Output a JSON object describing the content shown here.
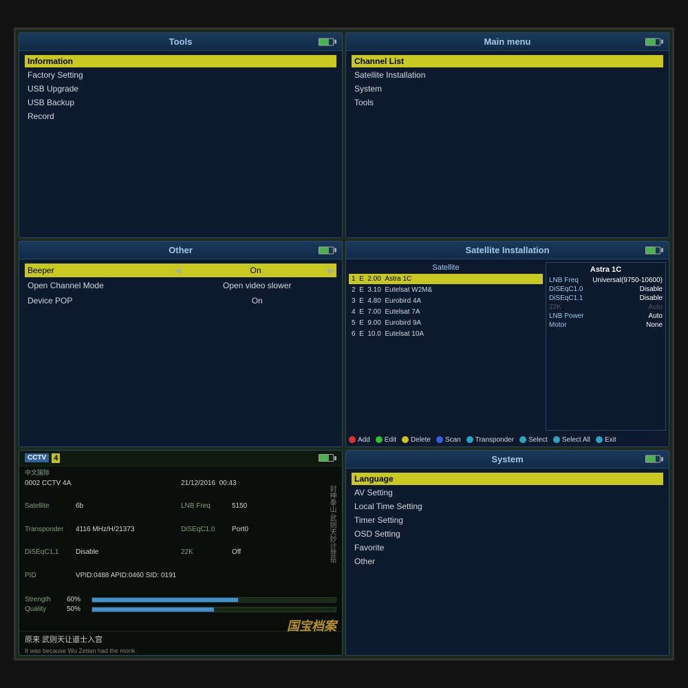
{
  "panels": {
    "tools": {
      "title": "Tools",
      "items": [
        {
          "label": "Information",
          "selected": true
        },
        {
          "label": "Factory Setting",
          "selected": false
        },
        {
          "label": "USB Upgrade",
          "selected": false
        },
        {
          "label": "USB Backup",
          "selected": false
        },
        {
          "label": "Record",
          "selected": false
        }
      ]
    },
    "main_menu": {
      "title": "Main menu",
      "items": [
        {
          "label": "Channel List",
          "selected": true
        },
        {
          "label": "Satellite Installation",
          "selected": false
        },
        {
          "label": "System",
          "selected": false
        },
        {
          "label": "Tools",
          "selected": false
        }
      ]
    },
    "other": {
      "title": "Other",
      "settings": [
        {
          "label": "Beeper",
          "value": "On",
          "selected": true
        },
        {
          "label": "Open Channel Mode",
          "value": "Open video slower",
          "selected": false
        },
        {
          "label": "Device POP",
          "value": "On",
          "selected": false
        }
      ]
    },
    "satellite": {
      "title": "Satellite Installation",
      "list_header": "Satellite",
      "satellites": [
        {
          "num": "1",
          "e": "E",
          "deg": "2.00",
          "name": "Astra 1C",
          "selected": true
        },
        {
          "num": "2",
          "e": "E",
          "deg": "3.10",
          "name": "Eutelsat W2M&",
          "selected": false
        },
        {
          "num": "3",
          "e": "E",
          "deg": "4.80",
          "name": "Eurobird 4A",
          "selected": false
        },
        {
          "num": "4",
          "e": "E",
          "deg": "7.00",
          "name": "Eutelsat 7A",
          "selected": false
        },
        {
          "num": "5",
          "e": "E",
          "deg": "9.00",
          "name": "Eurobird 9A",
          "selected": false
        },
        {
          "num": "6",
          "e": "E",
          "deg": "10.0",
          "name": "Eutelsat 10A",
          "selected": false
        }
      ],
      "details": {
        "title": "Astra 1C",
        "lnb_freq_label": "LNB Freq",
        "lnb_freq_value": "Universal(9750-10600)",
        "diseqc10_label": "DiSEqC1.0",
        "diseqc10_value": "Disable",
        "diseqc11_label": "DiSEqC1.1",
        "diseqc11_value": "Disable",
        "k22_label": "22K",
        "k22_value": "Auto",
        "lnb_power_label": "LNB Power",
        "lnb_power_value": "Auto",
        "motor_label": "Motor",
        "motor_value": "None"
      },
      "buttons": [
        {
          "color": "red",
          "label": "Add"
        },
        {
          "color": "green",
          "label": "Edit"
        },
        {
          "color": "yellow",
          "label": "Delete"
        },
        {
          "color": "blue",
          "label": "Scan"
        },
        {
          "color": "cyan",
          "label": "Transponder"
        },
        {
          "color": "cyan",
          "label": "Select"
        },
        {
          "color": "cyan",
          "label": "Select All"
        },
        {
          "color": "cyan",
          "label": "Exit"
        }
      ]
    },
    "signal": {
      "channel_name": "CCTV",
      "channel_num": "4",
      "subtitle": "中文国际",
      "info": {
        "code": "0002",
        "name": "CCTV 4A",
        "date": "21/12/2016",
        "time": "00:43",
        "satellite_label": "Satellite",
        "satellite_value": "6b",
        "lnb_freq_label": "LNB Freq",
        "lnb_freq_value": "5150",
        "transponder_label": "Transponder",
        "transponder_value": "4116 MHz/H/21373",
        "diseqc10_label": "DiSEqC1.0",
        "diseqc10_value": "Port0",
        "diseqc11_label": "DiSEqC1.1",
        "diseqc11_value": "Disable",
        "k22_label": "22K",
        "k22_value": "Off",
        "pid_label": "PID",
        "pid_value": "VPID:0488 APID:0460 SID: 0191",
        "strength_label": "Strength",
        "strength_pct": "60%",
        "strength_val": 60,
        "quality_label": "Quality",
        "quality_pct": "50%",
        "quality_val": 50
      },
      "caption_cn": "原来 武则天让道士入宫",
      "caption_en": "It was because Wu Zetian had the monk",
      "watermark": "国宝档案"
    },
    "system": {
      "title": "System",
      "items": [
        {
          "label": "Language",
          "selected": true
        },
        {
          "label": "AV Setting",
          "selected": false
        },
        {
          "label": "Local Time Setting",
          "selected": false
        },
        {
          "label": "Timer Setting",
          "selected": false
        },
        {
          "label": "OSD Setting",
          "selected": false
        },
        {
          "label": "Favorite",
          "selected": false
        },
        {
          "label": "Other",
          "selected": false
        }
      ]
    }
  }
}
